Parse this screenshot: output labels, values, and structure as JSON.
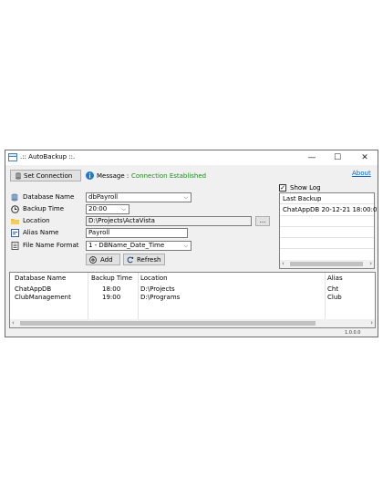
{
  "window": {
    "title": ".:: AutoBackup ::.",
    "minimize": "—",
    "maximize": "☐",
    "close": "✕"
  },
  "toolbar": {
    "set_connection": "Set Connection",
    "message_label": "Message :",
    "message_value": "Connection Established",
    "about": "About"
  },
  "form": {
    "database_name_label": "Database Name",
    "database_name_value": "dbPayroll",
    "backup_time_label": "Backup Time",
    "backup_time_value": "20:00",
    "location_label": "Location",
    "location_value": "D:\\Projects\\ActaVista",
    "browse": "...",
    "alias_label": "Alias Name",
    "alias_value": "Payroll",
    "file_name_format_label": "File Name Format",
    "file_name_format_value": "1 - DBName_Date_Time",
    "add": "Add",
    "refresh": "Refresh"
  },
  "log": {
    "show_log": "Show Log",
    "checked": true,
    "header": "Last Backup",
    "entries": [
      "ChatAppDB 20-12-21 18:00:0"
    ]
  },
  "table": {
    "columns": [
      "Database Name",
      "Backup Time",
      "Location",
      "Alias"
    ],
    "rows": [
      [
        "ChatAppDB",
        "18:00",
        "D:\\Projects",
        "Cht"
      ],
      [
        "ClubManagement",
        "19:00",
        "D:\\Programs",
        "Club"
      ]
    ]
  },
  "status": {
    "version": "1.0.0.0"
  },
  "colors": {
    "accent_link": "#0066cc",
    "message_green": "#1a8f1a",
    "info_blue": "#1e78d2"
  }
}
